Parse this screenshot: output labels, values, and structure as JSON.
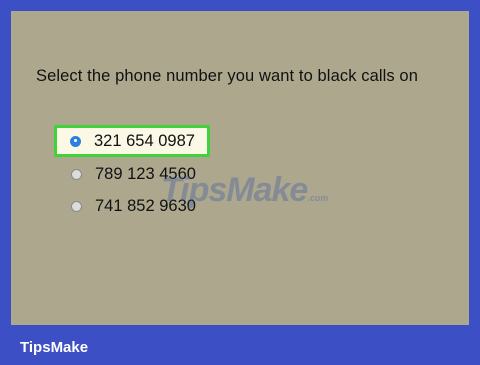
{
  "prompt": "Select the phone number you want to black calls on",
  "options": [
    {
      "number": "321 654 0987",
      "selected": true
    },
    {
      "number": "789 123 4560",
      "selected": false
    },
    {
      "number": "741 852 9630",
      "selected": false
    }
  ],
  "watermark": {
    "main": "TipsMake",
    "suffix": ".com"
  },
  "footer": {
    "brand": "TipsMake"
  },
  "colors": {
    "frame": "#3d4fc4",
    "panel": "#ada78e",
    "highlight_border": "#3fd23b",
    "radio_selected": "#2e7fe0"
  }
}
